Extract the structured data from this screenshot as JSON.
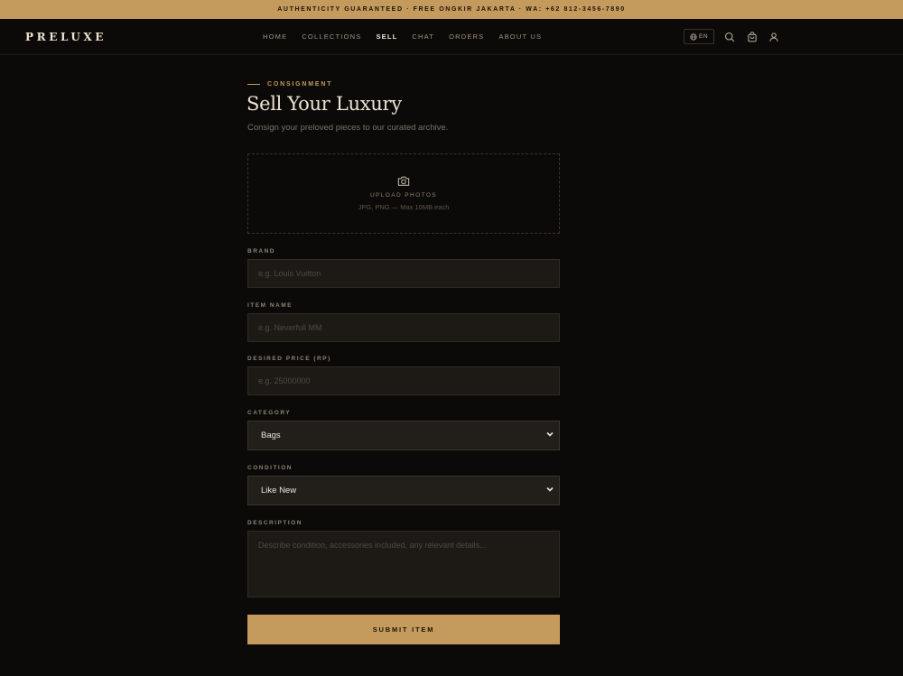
{
  "topbar": {
    "text": "AUTHENTICITY GUARANTEED · FREE ONGKIR JAKARTA · WA: +62 812-3456-7890"
  },
  "nav": {
    "logo": "PRELUXE",
    "items": [
      {
        "label": "HOME",
        "active": false
      },
      {
        "label": "COLLECTIONS",
        "active": false
      },
      {
        "label": "SELL",
        "active": true
      },
      {
        "label": "CHAT",
        "active": false
      },
      {
        "label": "ORDERS",
        "active": false
      },
      {
        "label": "ABOUT US",
        "active": false
      }
    ],
    "language": "EN",
    "icons": [
      "globe-icon",
      "search-icon",
      "cart-icon",
      "user-icon"
    ]
  },
  "page": {
    "eyebrow": "CONSIGNMENT",
    "title": "Sell Your Luxury",
    "subtitle": "Consign your preloved pieces to our curated archive."
  },
  "upload": {
    "icon": "camera-icon",
    "label": "UPLOAD PHOTOS",
    "hint": "JPG, PNG — Max 10MB each"
  },
  "form": {
    "brand": {
      "label": "BRAND",
      "placeholder": "e.g. Louis Vuitton",
      "value": ""
    },
    "item_name": {
      "label": "ITEM NAME",
      "placeholder": "e.g. Neverfull MM",
      "value": ""
    },
    "price": {
      "label": "DESIRED PRICE (RP)",
      "placeholder": "e.g. 25000000",
      "value": ""
    },
    "category": {
      "label": "CATEGORY",
      "value": "Bags"
    },
    "condition": {
      "label": "CONDITION",
      "value": "Like New"
    },
    "description": {
      "label": "DESCRIPTION",
      "placeholder": "Describe condition, accessories included, any relevant details..."
    },
    "submit_label": "SUBMIT ITEM"
  },
  "colors": {
    "accent": "#c59a5d",
    "background": "#0c0a08",
    "field": "#1d1a16",
    "text": "#ece3d3"
  }
}
